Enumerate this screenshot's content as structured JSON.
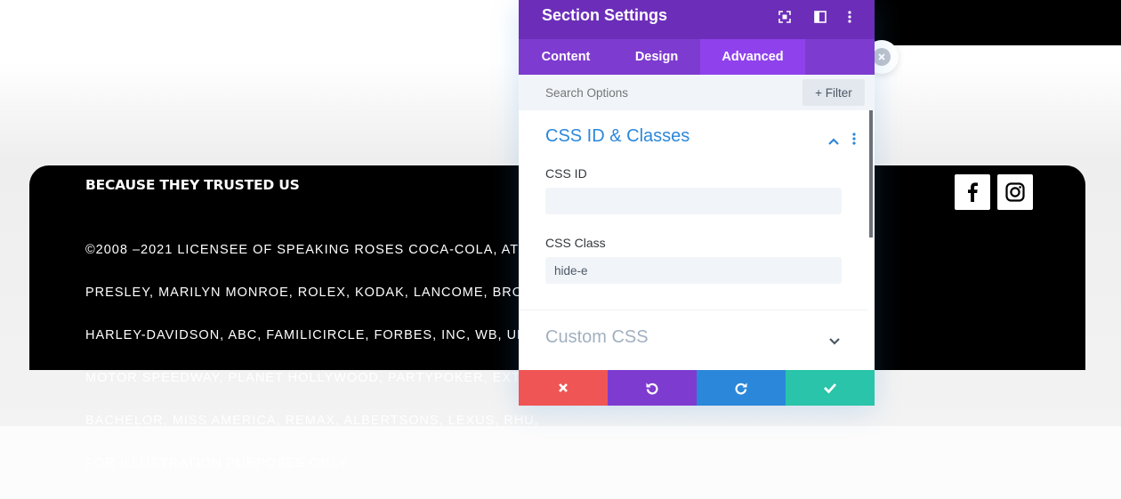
{
  "panel": {
    "title": "Section Settings",
    "tabs": [
      "Content",
      "Design",
      "Advanced"
    ],
    "active_tab": "Advanced",
    "search_placeholder": "Search Options",
    "filter_label": "+ Filter"
  },
  "groups": {
    "css_id_classes": {
      "title": "CSS ID & Classes",
      "css_id_label": "CSS ID",
      "css_id_value": "",
      "css_class_label": "CSS Class",
      "css_class_value": "hide-e"
    },
    "custom_css": {
      "title": "Custom CSS"
    }
  },
  "footer": {
    "heading": "BECAUSE THEY TRUSTED US",
    "lines": [
      "©2008 –2021 Licensee of Speaking Roses Coca-Cola, AT&T",
      "Presley, Marilyn Monroe, Rolex, Kodak, Lancome, Brow",
      "Harley-Davidson, ABC, FamiliCircle, Forbes, Inc, WB, Uni",
      "Motor Speedway, Planet Hollywood, PartyPoker, Extr",
      "Bachelor, Miss America, ReMax, Albertsons, Lexus, Rhu,",
      "for illustration purposes only"
    ],
    "social": [
      "facebook-icon",
      "instagram-icon"
    ]
  },
  "colors": {
    "header": "#6c2eb9",
    "tabs": "#7e3bd0",
    "active_tab": "#8f42ec",
    "accent_blue": "#2b87da",
    "discard": "#ef5555",
    "save": "#29c4a9"
  }
}
